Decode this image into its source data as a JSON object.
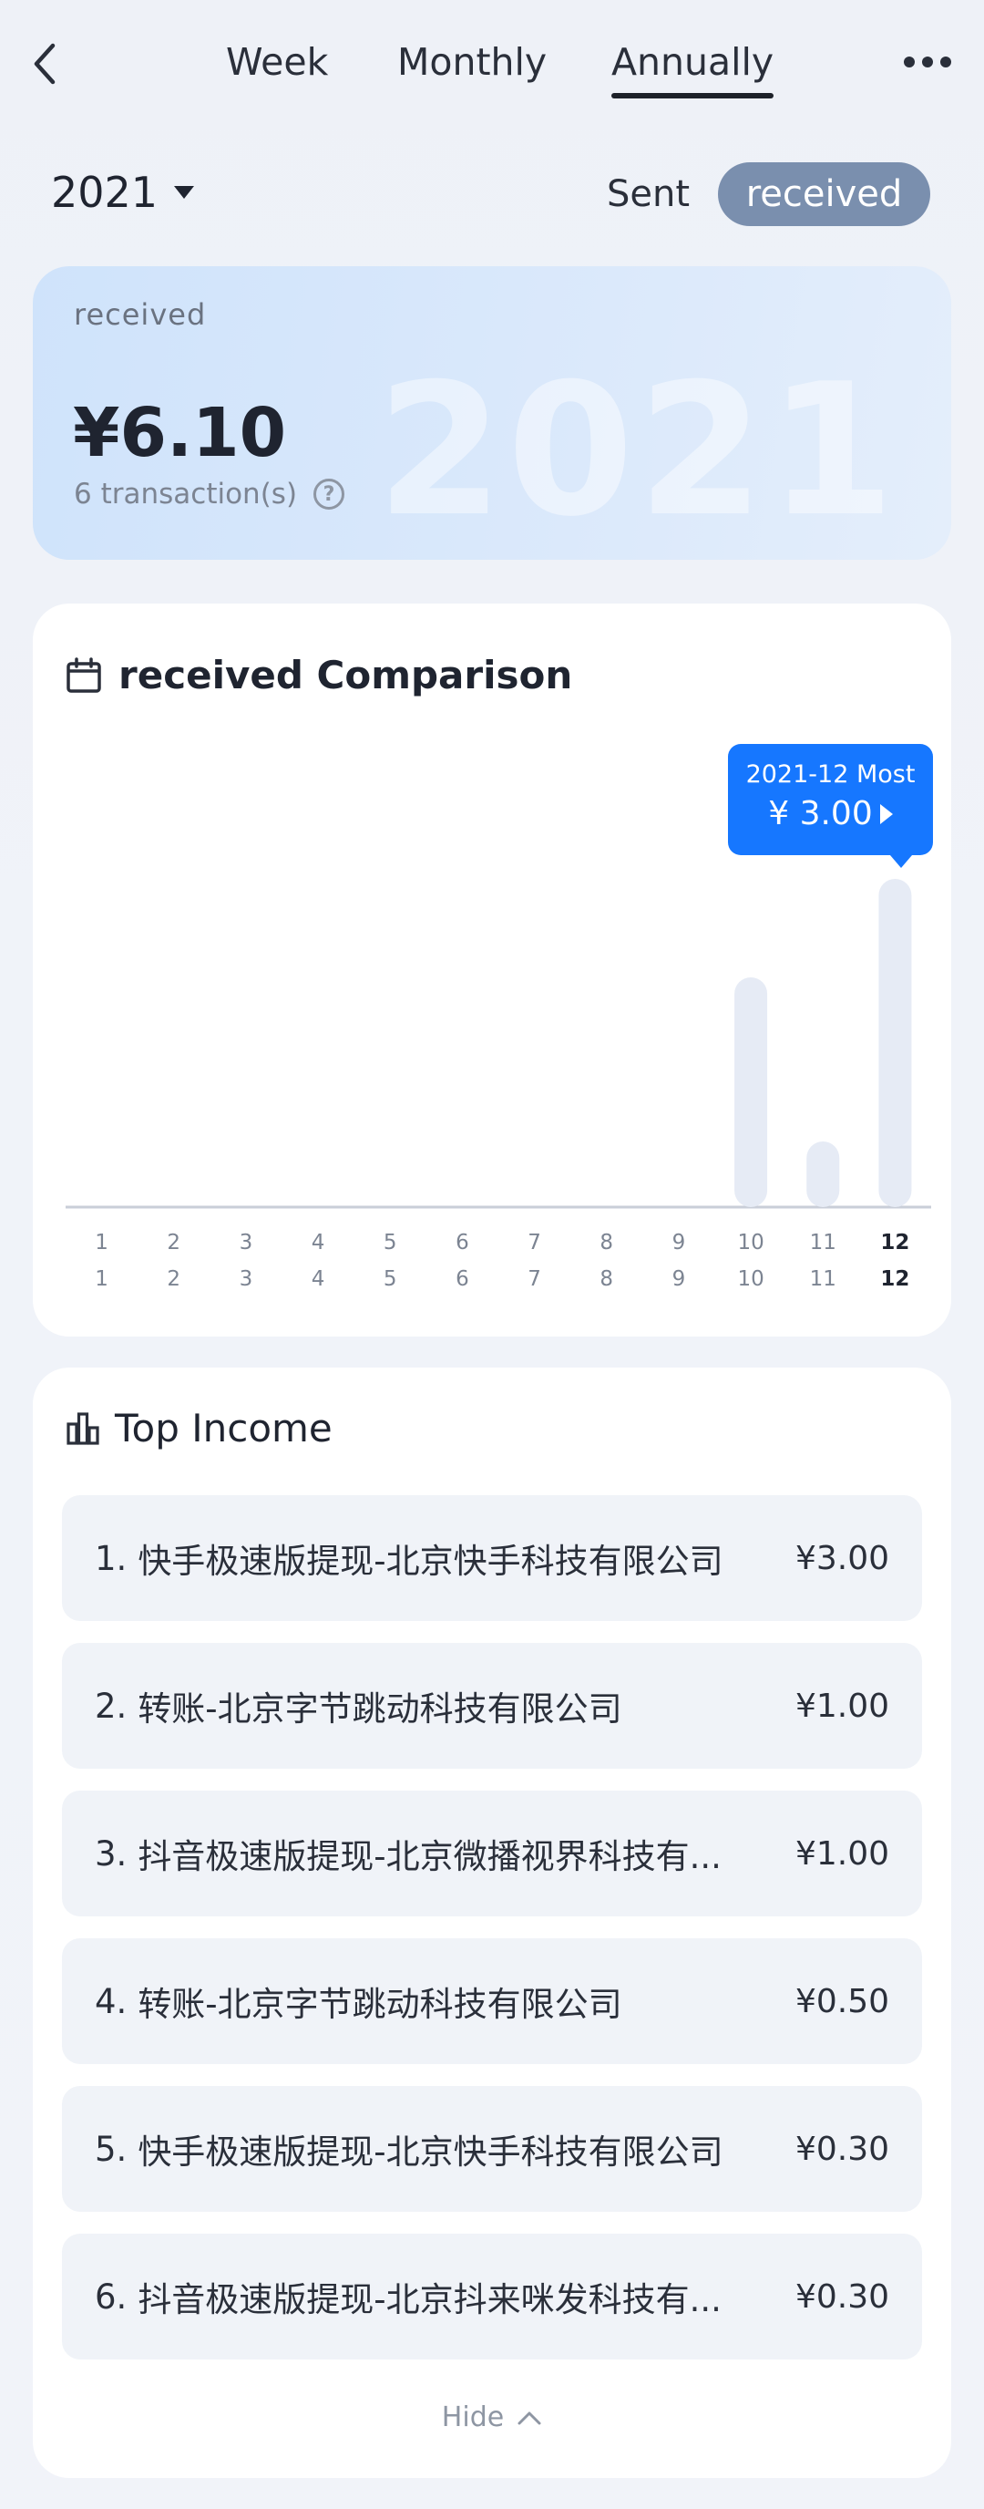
{
  "nav": {
    "tabs": [
      {
        "label": "Week"
      },
      {
        "label": "Monthly"
      },
      {
        "label": "Annually"
      }
    ],
    "active_tab": "Annually"
  },
  "filter": {
    "year": "2021",
    "sent_label": "Sent",
    "received_label": "received"
  },
  "summary": {
    "label": "received",
    "amount": "¥6.10",
    "count_text": "6 transaction(s)",
    "watermark_year": "2021",
    "help_glyph": "?"
  },
  "chart_section": {
    "title": "received Comparison",
    "tooltip_label": "2021-12 Most",
    "tooltip_value": "¥ 3.00"
  },
  "chart_data": {
    "type": "bar",
    "categories": [
      "1",
      "2",
      "3",
      "4",
      "5",
      "6",
      "7",
      "8",
      "9",
      "10",
      "11",
      "12"
    ],
    "values": [
      0,
      0,
      0,
      0,
      0,
      0,
      0,
      0,
      0,
      2.1,
      0.6,
      3.0
    ],
    "ylim": [
      0,
      3.0
    ],
    "highlight_category": "12"
  },
  "top_income": {
    "title": "Top Income",
    "items": [
      {
        "rank": "1.",
        "name": "快手极速版提现-北京快手科技有限公司",
        "amount": "¥3.00"
      },
      {
        "rank": "2.",
        "name": "转账-北京字节跳动科技有限公司",
        "amount": "¥1.00"
      },
      {
        "rank": "3.",
        "name": "抖音极速版提现-北京微播视界科技有...",
        "amount": "¥1.00"
      },
      {
        "rank": "4.",
        "name": "转账-北京字节跳动科技有限公司",
        "amount": "¥0.50"
      },
      {
        "rank": "5.",
        "name": "快手极速版提现-北京快手科技有限公司",
        "amount": "¥0.30"
      },
      {
        "rank": "6.",
        "name": "抖音极速版提现-北京抖来咪发科技有...",
        "amount": "¥0.30"
      }
    ],
    "hide_label": "Hide"
  },
  "colors": {
    "accent": "#1677ff",
    "toggle_active": "#7a8fae",
    "bar": "#e6ebf5"
  },
  "icons": {
    "back": "chevron-left-icon",
    "more": "more-dots-icon",
    "year_caret": "caret-down-icon",
    "help": "question-circle-icon",
    "calendar": "calendar-icon",
    "bars": "bar-chart-icon",
    "hide": "chevron-up-icon"
  }
}
